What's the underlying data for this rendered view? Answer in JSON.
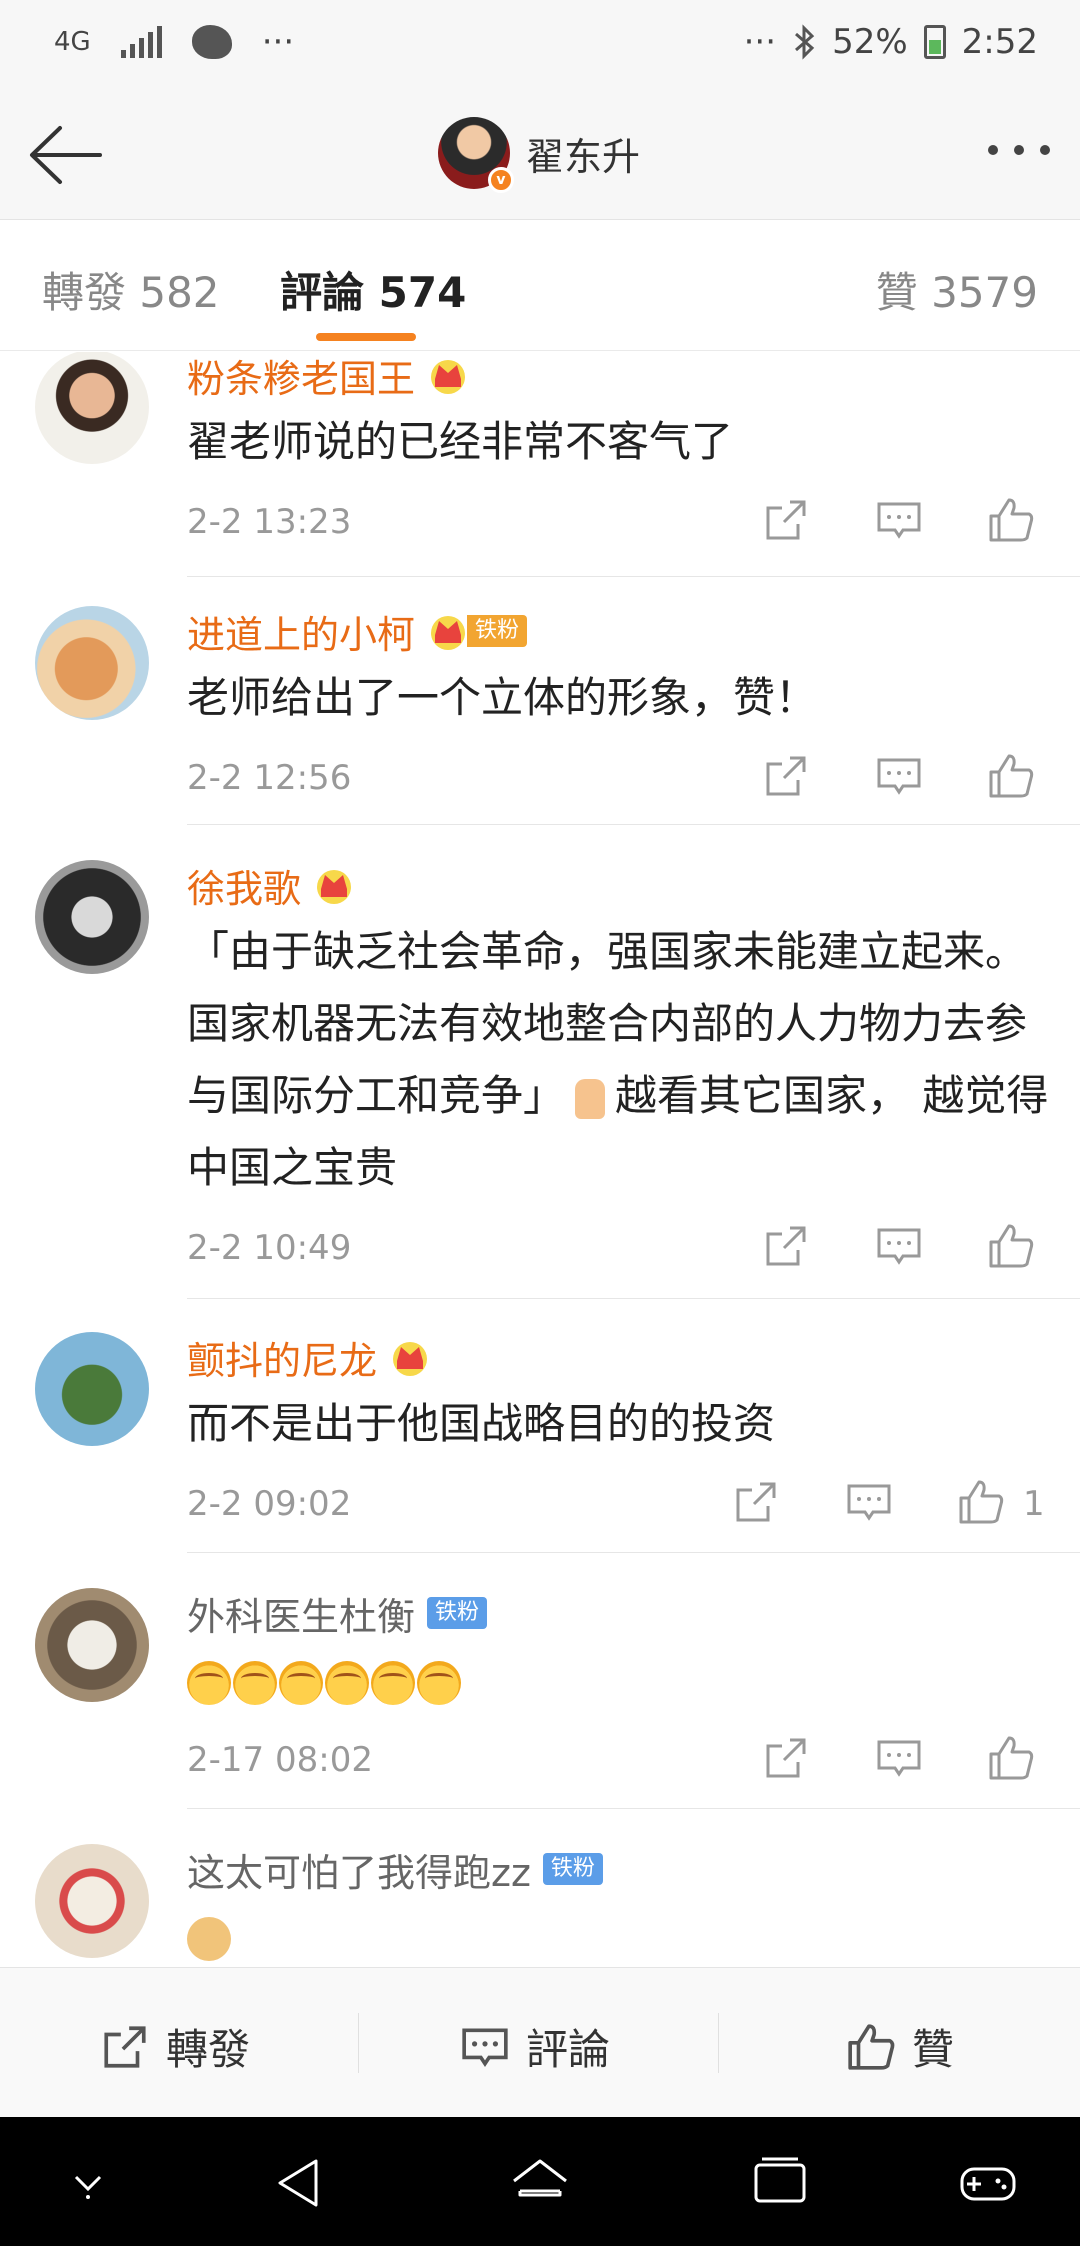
{
  "status_bar": {
    "network": "4G",
    "dots_left": "···",
    "dots_right": "···",
    "battery": "52%",
    "time": "2:52"
  },
  "header": {
    "title": "翟东升"
  },
  "tabs": [
    {
      "label": "轉發 582"
    },
    {
      "label": "評論 574"
    },
    {
      "label": "贊 3579"
    }
  ],
  "comments": [
    {
      "name": "粉条糁老国王",
      "text": "翟老师说的已经非常不客气了",
      "time": "2-2 13:23",
      "likes": ""
    },
    {
      "name": "进道上的小柯",
      "badge": "铁粉",
      "text": "老师给出了一个立体的形象，赞！",
      "time": "2-2 12:56",
      "likes": ""
    },
    {
      "name": "徐我歌",
      "text": "「由于缺乏社会革命，强国家未能建立起来。国家机器无法有效地整合内部的人力物力去参与国际分工和竞争」",
      "text2": "越看其它国家， 越觉得中国之宝贵",
      "time": "2-2 10:49",
      "likes": ""
    },
    {
      "name": "颤抖的尼龙",
      "text": "而不是出于他国战略目的的投资",
      "time": "2-2 09:02",
      "likes": "1"
    },
    {
      "name": "外科医生杜衡",
      "badge": "铁粉",
      "text": "",
      "time": "2-17 08:02",
      "likes": ""
    },
    {
      "name": "这太可怕了我得跑zz",
      "badge": "铁粉",
      "text": "",
      "time": "",
      "likes": ""
    }
  ],
  "action_bar": {
    "repost": "轉發",
    "comment": "評論",
    "like": "贊"
  },
  "colors": {
    "accent": "#f58220",
    "name_orange": "#e86b16",
    "iron_badge": "#5b9de8"
  }
}
